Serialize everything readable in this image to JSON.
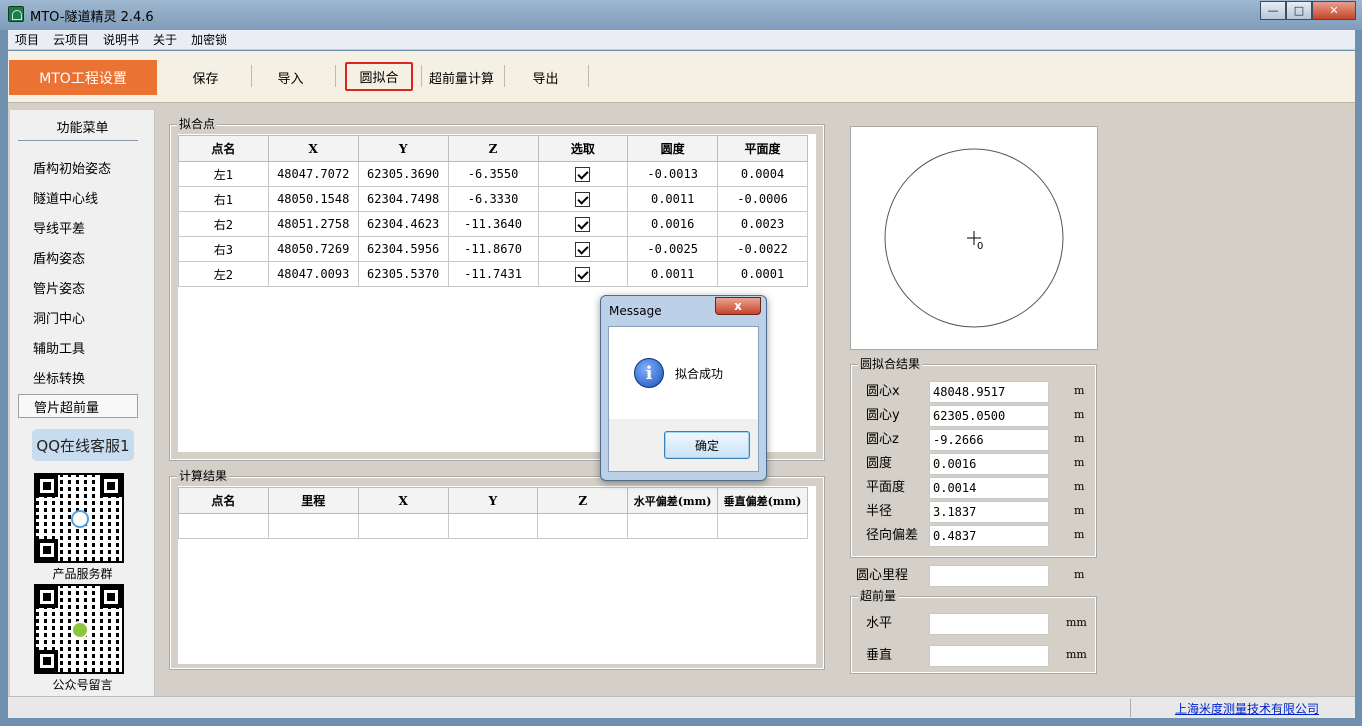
{
  "window": {
    "title": "MTO-隧道精灵 2.4.6"
  },
  "menu": [
    "项目",
    "云项目",
    "说明书",
    "关于",
    "加密锁"
  ],
  "toolbar": {
    "brand": "MTO工程设置",
    "buttons": [
      "保存",
      "导入",
      "圆拟合",
      "超前量计算",
      "导出"
    ]
  },
  "sidebar": {
    "title": "功能菜单",
    "items": [
      "盾构初始姿态",
      "隧道中心线",
      "导线平差",
      "盾构姿态",
      "管片姿态",
      "洞门中心",
      "辅助工具",
      "坐标转换",
      "管片超前量"
    ],
    "qq_button": "QQ在线客服1",
    "qr1_caption": "产品服务群",
    "qr2_caption": "公众号留言"
  },
  "fit_points": {
    "group_label": "拟合点",
    "headers": [
      "点名",
      "X",
      "Y",
      "Z",
      "选取",
      "圆度",
      "平面度"
    ],
    "rows": [
      {
        "name": "左1",
        "x": "48047.7072",
        "y": "62305.3690",
        "z": "-6.3550",
        "checked": true,
        "roundness": "-0.0013",
        "flatness": "0.0004"
      },
      {
        "name": "右1",
        "x": "48050.1548",
        "y": "62304.7498",
        "z": "-6.3330",
        "checked": true,
        "roundness": "0.0011",
        "flatness": "-0.0006"
      },
      {
        "name": "右2",
        "x": "48051.2758",
        "y": "62304.4623",
        "z": "-11.3640",
        "checked": true,
        "roundness": "0.0016",
        "flatness": "0.0023"
      },
      {
        "name": "右3",
        "x": "48050.7269",
        "y": "62304.5956",
        "z": "-11.8670",
        "checked": true,
        "roundness": "-0.0025",
        "flatness": "-0.0022"
      },
      {
        "name": "左2",
        "x": "48047.0093",
        "y": "62305.5370",
        "z": "-11.7431",
        "checked": true,
        "roundness": "0.0011",
        "flatness": "0.0001"
      }
    ]
  },
  "calc_results": {
    "group_label": "计算结果",
    "headers": [
      "点名",
      "里程",
      "X",
      "Y",
      "Z",
      "水平偏差(mm)",
      "垂直偏差(mm)"
    ]
  },
  "preview": {
    "center_label": "0"
  },
  "circle_fit": {
    "group_label": "圆拟合结果",
    "fields": [
      {
        "label": "圆心x",
        "value": "48048.9517",
        "unit": "m"
      },
      {
        "label": "圆心y",
        "value": "62305.0500",
        "unit": "m"
      },
      {
        "label": "圆心z",
        "value": "-9.2666",
        "unit": "m"
      },
      {
        "label": "圆度",
        "value": "0.0016",
        "unit": "m"
      },
      {
        "label": "平面度",
        "value": "0.0014",
        "unit": "m"
      },
      {
        "label": "半径",
        "value": "3.1837",
        "unit": "m"
      },
      {
        "label": "径向偏差",
        "value": "0.4837",
        "unit": "m"
      }
    ]
  },
  "center_mileage": {
    "label": "圆心里程",
    "value": "",
    "unit": "m"
  },
  "advance": {
    "group_label": "超前量",
    "horizontal": {
      "label": "水平",
      "value": "",
      "unit": "mm"
    },
    "vertical": {
      "label": "垂直",
      "value": "",
      "unit": "mm"
    }
  },
  "status": {
    "link": "上海米度测量技术有限公司"
  },
  "dialog": {
    "title": "Message",
    "close": "x",
    "message": "拟合成功",
    "ok": "确定"
  },
  "colors": {
    "brand": "#ea7232",
    "highlight": "#d9261c",
    "link": "#0022cc"
  }
}
